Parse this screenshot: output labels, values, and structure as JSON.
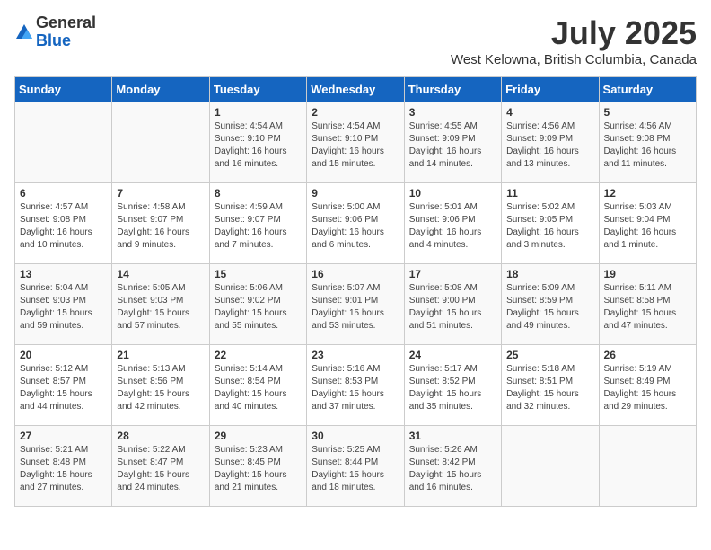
{
  "header": {
    "logo_line1": "General",
    "logo_line2": "Blue",
    "month_title": "July 2025",
    "location": "West Kelowna, British Columbia, Canada"
  },
  "weekdays": [
    "Sunday",
    "Monday",
    "Tuesday",
    "Wednesday",
    "Thursday",
    "Friday",
    "Saturday"
  ],
  "weeks": [
    [
      {
        "day": "",
        "info": ""
      },
      {
        "day": "",
        "info": ""
      },
      {
        "day": "1",
        "info": "Sunrise: 4:54 AM\nSunset: 9:10 PM\nDaylight: 16 hours and 16 minutes."
      },
      {
        "day": "2",
        "info": "Sunrise: 4:54 AM\nSunset: 9:10 PM\nDaylight: 16 hours and 15 minutes."
      },
      {
        "day": "3",
        "info": "Sunrise: 4:55 AM\nSunset: 9:09 PM\nDaylight: 16 hours and 14 minutes."
      },
      {
        "day": "4",
        "info": "Sunrise: 4:56 AM\nSunset: 9:09 PM\nDaylight: 16 hours and 13 minutes."
      },
      {
        "day": "5",
        "info": "Sunrise: 4:56 AM\nSunset: 9:08 PM\nDaylight: 16 hours and 11 minutes."
      }
    ],
    [
      {
        "day": "6",
        "info": "Sunrise: 4:57 AM\nSunset: 9:08 PM\nDaylight: 16 hours and 10 minutes."
      },
      {
        "day": "7",
        "info": "Sunrise: 4:58 AM\nSunset: 9:07 PM\nDaylight: 16 hours and 9 minutes."
      },
      {
        "day": "8",
        "info": "Sunrise: 4:59 AM\nSunset: 9:07 PM\nDaylight: 16 hours and 7 minutes."
      },
      {
        "day": "9",
        "info": "Sunrise: 5:00 AM\nSunset: 9:06 PM\nDaylight: 16 hours and 6 minutes."
      },
      {
        "day": "10",
        "info": "Sunrise: 5:01 AM\nSunset: 9:06 PM\nDaylight: 16 hours and 4 minutes."
      },
      {
        "day": "11",
        "info": "Sunrise: 5:02 AM\nSunset: 9:05 PM\nDaylight: 16 hours and 3 minutes."
      },
      {
        "day": "12",
        "info": "Sunrise: 5:03 AM\nSunset: 9:04 PM\nDaylight: 16 hours and 1 minute."
      }
    ],
    [
      {
        "day": "13",
        "info": "Sunrise: 5:04 AM\nSunset: 9:03 PM\nDaylight: 15 hours and 59 minutes."
      },
      {
        "day": "14",
        "info": "Sunrise: 5:05 AM\nSunset: 9:03 PM\nDaylight: 15 hours and 57 minutes."
      },
      {
        "day": "15",
        "info": "Sunrise: 5:06 AM\nSunset: 9:02 PM\nDaylight: 15 hours and 55 minutes."
      },
      {
        "day": "16",
        "info": "Sunrise: 5:07 AM\nSunset: 9:01 PM\nDaylight: 15 hours and 53 minutes."
      },
      {
        "day": "17",
        "info": "Sunrise: 5:08 AM\nSunset: 9:00 PM\nDaylight: 15 hours and 51 minutes."
      },
      {
        "day": "18",
        "info": "Sunrise: 5:09 AM\nSunset: 8:59 PM\nDaylight: 15 hours and 49 minutes."
      },
      {
        "day": "19",
        "info": "Sunrise: 5:11 AM\nSunset: 8:58 PM\nDaylight: 15 hours and 47 minutes."
      }
    ],
    [
      {
        "day": "20",
        "info": "Sunrise: 5:12 AM\nSunset: 8:57 PM\nDaylight: 15 hours and 44 minutes."
      },
      {
        "day": "21",
        "info": "Sunrise: 5:13 AM\nSunset: 8:56 PM\nDaylight: 15 hours and 42 minutes."
      },
      {
        "day": "22",
        "info": "Sunrise: 5:14 AM\nSunset: 8:54 PM\nDaylight: 15 hours and 40 minutes."
      },
      {
        "day": "23",
        "info": "Sunrise: 5:16 AM\nSunset: 8:53 PM\nDaylight: 15 hours and 37 minutes."
      },
      {
        "day": "24",
        "info": "Sunrise: 5:17 AM\nSunset: 8:52 PM\nDaylight: 15 hours and 35 minutes."
      },
      {
        "day": "25",
        "info": "Sunrise: 5:18 AM\nSunset: 8:51 PM\nDaylight: 15 hours and 32 minutes."
      },
      {
        "day": "26",
        "info": "Sunrise: 5:19 AM\nSunset: 8:49 PM\nDaylight: 15 hours and 29 minutes."
      }
    ],
    [
      {
        "day": "27",
        "info": "Sunrise: 5:21 AM\nSunset: 8:48 PM\nDaylight: 15 hours and 27 minutes."
      },
      {
        "day": "28",
        "info": "Sunrise: 5:22 AM\nSunset: 8:47 PM\nDaylight: 15 hours and 24 minutes."
      },
      {
        "day": "29",
        "info": "Sunrise: 5:23 AM\nSunset: 8:45 PM\nDaylight: 15 hours and 21 minutes."
      },
      {
        "day": "30",
        "info": "Sunrise: 5:25 AM\nSunset: 8:44 PM\nDaylight: 15 hours and 18 minutes."
      },
      {
        "day": "31",
        "info": "Sunrise: 5:26 AM\nSunset: 8:42 PM\nDaylight: 15 hours and 16 minutes."
      },
      {
        "day": "",
        "info": ""
      },
      {
        "day": "",
        "info": ""
      }
    ]
  ]
}
